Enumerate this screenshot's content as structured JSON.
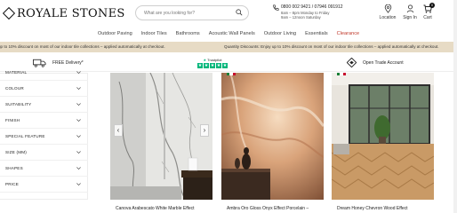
{
  "header": {
    "logo_text": "ROYALE STONES",
    "search_placeholder": "What are you looking for?",
    "phone": "0800 002 9421 / 07946 091912",
    "hours_line1": "8am – 8pm Monday to Friday",
    "hours_line2": "9am – 12noon Saturday",
    "location_label": "Location",
    "signin_label": "Sign In",
    "cart_label": "Cart",
    "cart_count": "0"
  },
  "nav": {
    "items": [
      "Outdoor Paving",
      "Indoor Tiles",
      "Bathrooms",
      "Acoustic Wall Panels",
      "Outdoor Living",
      "Essentials",
      "Clearance"
    ]
  },
  "promo": {
    "left_text": "up to 10% discount on most of our indoor tile collections – applied automatically at checkout.",
    "right_text": "Quantity Discounts: Enjoy up to 10% discount on most of our indoor tile collections – applied automatically at checkout."
  },
  "usp": {
    "delivery": "FREE Delivery*",
    "trustpilot": "Trustpilot",
    "trade": "Open Trade Account"
  },
  "filters": [
    "MATERIAL",
    "COLOUR",
    "SUITABILITY",
    "FINISH",
    "SPECIAL FEATURE",
    "SIZE (MM)",
    "SHAPES",
    "PRICE"
  ],
  "products": [
    {
      "name": "Canova Arabescato White Marble Effect"
    },
    {
      "name": "Ambra Oro Gloss Onyx Effect Porcelain –"
    },
    {
      "name": "Dream Honey Chevron Wood Effect"
    }
  ],
  "colors": {
    "promo_bg": "#e7dbc5",
    "trustpilot_green": "#00b67a",
    "clearance_red": "#c0392b"
  }
}
